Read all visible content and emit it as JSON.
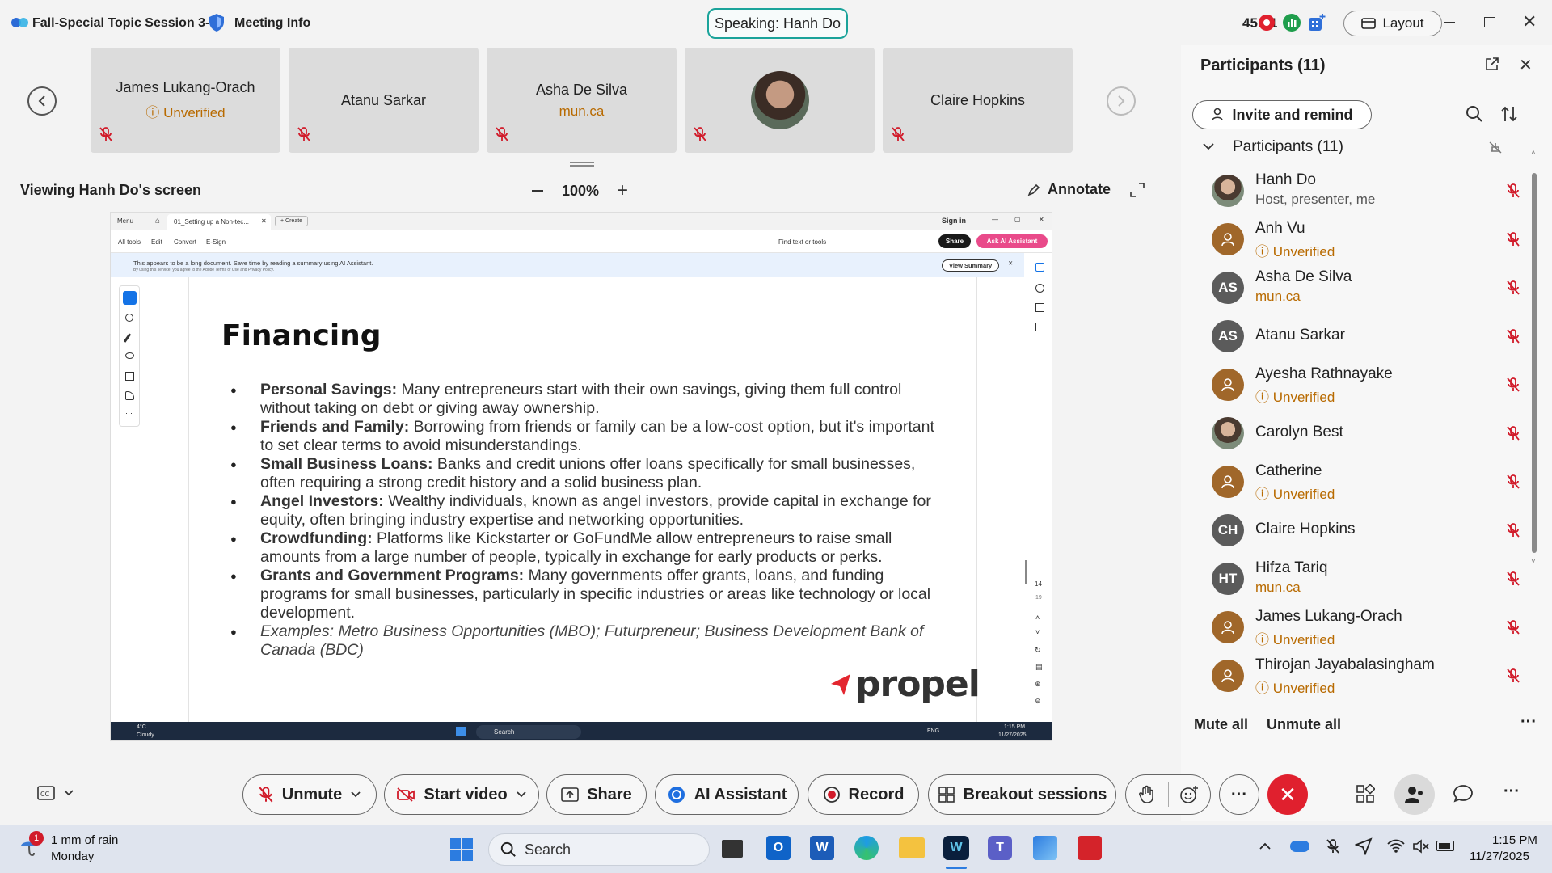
{
  "topbar": {
    "meeting_title": "Fall-Special Topic Session 3-8",
    "meeting_info": "Meeting Info",
    "speaking": "Speaking: Hanh Do",
    "timer": "45:21",
    "layout_label": "Layout"
  },
  "tiles": [
    {
      "name": "James Lukang-Orach",
      "sub": "Unverified"
    },
    {
      "name": "Atanu Sarkar",
      "sub": ""
    },
    {
      "name": "Asha De Silva",
      "sub": "mun.ca"
    },
    {
      "name": "",
      "sub": ""
    },
    {
      "name": "Claire Hopkins",
      "sub": ""
    }
  ],
  "viewing": {
    "label": "Viewing Hanh Do's screen",
    "zoom": "100%",
    "annotate": "Annotate"
  },
  "shared": {
    "tab_label": "01_Setting up a Non-tec...",
    "create": "Create",
    "menu": "Menu",
    "sign_in": "Sign in",
    "menu_items": [
      "All tools",
      "Edit",
      "Convert",
      "E-Sign"
    ],
    "find_text": "Find text or tools",
    "share": "Share",
    "ask_ai": "Ask AI Assistant",
    "banner": "This appears to be a long document. Save time by reading a summary using AI Assistant.",
    "banner_sub": "By using this service, you agree to the Adobe Terms of Use and Privacy Policy.",
    "view_summary": "View Summary",
    "page_number": "14",
    "page_total": "19",
    "doc_title": "Financing",
    "bullets": [
      {
        "head": "Personal Savings:",
        "text": " Many entrepreneurs start with their own savings, giving them full control without taking on debt or giving away ownership."
      },
      {
        "head": "Friends and Family:",
        "text": " Borrowing from friends or family can be a low-cost option, but it's important to set clear terms to avoid misunderstandings."
      },
      {
        "head": "Small Business Loans:",
        "text": " Banks and credit unions offer loans specifically for small businesses, often requiring a strong credit history and a solid business plan."
      },
      {
        "head": "Angel Investors:",
        "text": " Wealthy individuals, known as angel investors, provide capital in exchange for equity, often bringing industry expertise and networking opportunities."
      },
      {
        "head": "Crowdfunding:",
        "text": " Platforms like Kickstarter or GoFundMe allow entrepreneurs to raise small amounts from a large number of people, typically in exchange for early products or perks."
      },
      {
        "head": "Grants and Government Programs:",
        "text": " Many governments offer grants, loans, and funding programs for small businesses, particularly in specific industries or areas like technology or local development."
      }
    ],
    "examples": "Examples: Metro Business Opportunities (MBO); Futurpreneur; Business Development Bank of Canada (BDC)",
    "logo": "propel",
    "inner_taskbar": {
      "weather_temp": "4°C",
      "weather": "Cloudy",
      "search": "Search",
      "lang": "ENG",
      "time": "1:15 PM",
      "date": "11/27/2025"
    }
  },
  "panel": {
    "title": "Participants (11)",
    "invite": "Invite and remind",
    "section": "Participants (11)",
    "participants": [
      {
        "name": "Hanh Do",
        "sub": "Host, presenter, me",
        "initials": "",
        "kind": "photo",
        "subcolor": "#555555"
      },
      {
        "name": "Anh Vu",
        "sub": "Unverified",
        "initials": "",
        "kind": "guest",
        "subcolor": "#b86a00"
      },
      {
        "name": "Asha De Silva",
        "sub": "mun.ca",
        "initials": "AS",
        "kind": "initials",
        "subcolor": "#b86a00"
      },
      {
        "name": "Atanu Sarkar",
        "sub": "",
        "initials": "AS",
        "kind": "initials",
        "subcolor": "#b86a00"
      },
      {
        "name": "Ayesha Rathnayake",
        "sub": "Unverified",
        "initials": "",
        "kind": "guest",
        "subcolor": "#b86a00"
      },
      {
        "name": "Carolyn Best",
        "sub": "",
        "initials": "",
        "kind": "photo",
        "subcolor": "#b86a00"
      },
      {
        "name": "Catherine",
        "sub": "Unverified",
        "initials": "",
        "kind": "guest",
        "subcolor": "#b86a00"
      },
      {
        "name": "Claire Hopkins",
        "sub": "",
        "initials": "CH",
        "kind": "initials",
        "subcolor": "#b86a00"
      },
      {
        "name": "Hifza Tariq",
        "sub": "mun.ca",
        "initials": "HT",
        "kind": "initials",
        "subcolor": "#b86a00"
      },
      {
        "name": "James Lukang-Orach",
        "sub": "Unverified",
        "initials": "",
        "kind": "guest",
        "subcolor": "#b86a00"
      },
      {
        "name": "Thirojan Jayabalasingham",
        "sub": "Unverified",
        "initials": "",
        "kind": "guest",
        "subcolor": "#b86a00"
      }
    ],
    "mute_all": "Mute all",
    "unmute_all": "Unmute all"
  },
  "toolbar": {
    "unmute": "Unmute",
    "start_video": "Start video",
    "share": "Share",
    "ai_assistant": "AI Assistant",
    "record": "Record",
    "breakout": "Breakout sessions"
  },
  "taskbar": {
    "weather_badge": "1",
    "weather_line1": "1 mm of rain",
    "weather_line2": "Monday",
    "search": "Search",
    "time": "1:15 PM",
    "date": "11/27/2025"
  },
  "colors": {
    "accent_teal": "#1aa39a",
    "guest_brown": "#a0672a",
    "initials_gray": "#5b5b5b",
    "end_red": "#e0202e",
    "mute_red": "#d11b2a"
  }
}
